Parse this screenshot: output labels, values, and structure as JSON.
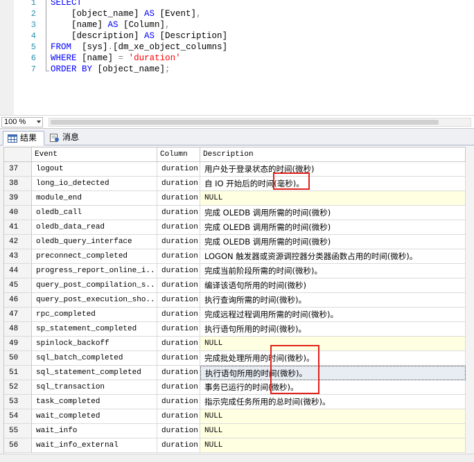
{
  "editor": {
    "lines": [
      {
        "num": "1",
        "tokens": [
          {
            "t": "SELECT",
            "c": "kw"
          }
        ]
      },
      {
        "num": "2",
        "tokens": [
          {
            "t": "    [object_name] ",
            "c": ""
          },
          {
            "t": "AS",
            "c": "kw"
          },
          {
            "t": " [Event]",
            "c": ""
          },
          {
            "t": ",",
            "c": "gr"
          }
        ]
      },
      {
        "num": "3",
        "tokens": [
          {
            "t": "    [name] ",
            "c": ""
          },
          {
            "t": "AS",
            "c": "kw"
          },
          {
            "t": " [Column]",
            "c": ""
          },
          {
            "t": ",",
            "c": "gr"
          }
        ]
      },
      {
        "num": "4",
        "tokens": [
          {
            "t": "    [description] ",
            "c": ""
          },
          {
            "t": "AS",
            "c": "kw"
          },
          {
            "t": " [Description]",
            "c": ""
          }
        ]
      },
      {
        "num": "5",
        "tokens": [
          {
            "t": "FROM",
            "c": "kw"
          },
          {
            "t": "  [sys]",
            "c": ""
          },
          {
            "t": ".",
            "c": "gr"
          },
          {
            "t": "[dm_xe_object_columns]",
            "c": ""
          }
        ]
      },
      {
        "num": "6",
        "tokens": [
          {
            "t": "WHERE",
            "c": "kw"
          },
          {
            "t": " [name] ",
            "c": ""
          },
          {
            "t": "=",
            "c": "gr"
          },
          {
            "t": " ",
            "c": ""
          },
          {
            "t": "'duration'",
            "c": "str"
          }
        ]
      },
      {
        "num": "7",
        "tokens": [
          {
            "t": "ORDER BY",
            "c": "kw"
          },
          {
            "t": " [object_name]",
            "c": ""
          },
          {
            "t": ";",
            "c": "gr"
          }
        ]
      }
    ]
  },
  "zoom": {
    "value": "100 %"
  },
  "tabs": {
    "results": "结果",
    "messages": "消息"
  },
  "grid": {
    "headers": {
      "event": "Event",
      "column": "Column",
      "description": "Description"
    },
    "rows": [
      {
        "rn": "37",
        "event": "logout",
        "column": "duration",
        "desc": "用户处于登录状态的时间(微秒)",
        "null": false
      },
      {
        "rn": "38",
        "event": "long_io_detected",
        "column": "duration",
        "desc": "自 IO 开始后的时间(毫秒)。",
        "null": false
      },
      {
        "rn": "39",
        "event": "module_end",
        "column": "duration",
        "desc": "NULL",
        "null": true
      },
      {
        "rn": "40",
        "event": "oledb_call",
        "column": "duration",
        "desc": "完成 OLEDB 调用所需的时间(微秒)",
        "null": false
      },
      {
        "rn": "41",
        "event": "oledb_data_read",
        "column": "duration",
        "desc": "完成 OLEDB 调用所需的时间(微秒)",
        "null": false
      },
      {
        "rn": "42",
        "event": "oledb_query_interface",
        "column": "duration",
        "desc": "完成 OLEDB 调用所需的时间(微秒)",
        "null": false
      },
      {
        "rn": "43",
        "event": "preconnect_completed",
        "column": "duration",
        "desc": "LOGON 触发器或资源调控器分类器函数占用的时间(微秒)。",
        "null": false
      },
      {
        "rn": "44",
        "event": "progress_report_online_i...",
        "column": "duration",
        "desc": "完成当前阶段所需的时间(微秒)。",
        "null": false
      },
      {
        "rn": "45",
        "event": "query_post_compilation_s...",
        "column": "duration",
        "desc": "编译该语句所用的时间(微秒)",
        "null": false
      },
      {
        "rn": "46",
        "event": "query_post_execution_sho...",
        "column": "duration",
        "desc": "执行查询所需的时间(微秒)。",
        "null": false
      },
      {
        "rn": "47",
        "event": "rpc_completed",
        "column": "duration",
        "desc": "完成远程过程调用所需的时间(微秒)。",
        "null": false
      },
      {
        "rn": "48",
        "event": "sp_statement_completed",
        "column": "duration",
        "desc": "执行语句所用的时间(微秒)。",
        "null": false
      },
      {
        "rn": "49",
        "event": "spinlock_backoff",
        "column": "duration",
        "desc": "NULL",
        "null": true
      },
      {
        "rn": "50",
        "event": "sql_batch_completed",
        "column": "duration",
        "desc": "完成批处理所用的时间(微秒)。",
        "null": false
      },
      {
        "rn": "51",
        "event": "sql_statement_completed",
        "column": "duration",
        "desc": "执行语句所用的时间(微秒)。",
        "null": false,
        "selected": true
      },
      {
        "rn": "52",
        "event": "sql_transaction",
        "column": "duration",
        "desc": "事务已运行的时间(微秒)。",
        "null": false
      },
      {
        "rn": "53",
        "event": "task_completed",
        "column": "duration",
        "desc": "指示完成任务所用的总时间(微秒)。",
        "null": false
      },
      {
        "rn": "54",
        "event": "wait_completed",
        "column": "duration",
        "desc": "NULL",
        "null": true
      },
      {
        "rn": "55",
        "event": "wait_info",
        "column": "duration",
        "desc": "NULL",
        "null": true
      },
      {
        "rn": "56",
        "event": "wait_info_external",
        "column": "duration",
        "desc": "NULL",
        "null": true
      }
    ]
  },
  "colors": {
    "keyword": "#0000ff",
    "string": "#ff0000",
    "line_number": "#2b91af",
    "null_cell": "#ffffe1",
    "highlight_box": "#e0201a"
  }
}
